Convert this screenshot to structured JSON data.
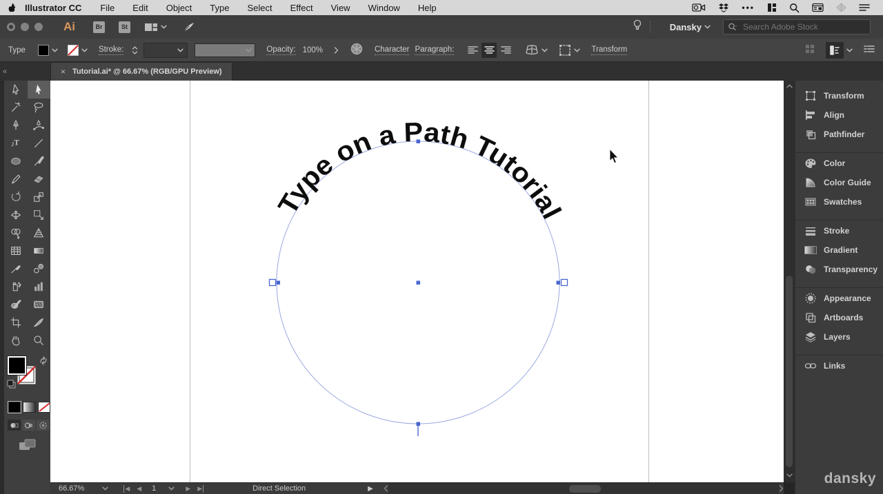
{
  "menubar": {
    "app_name": "Illustrator CC",
    "menus": [
      "File",
      "Edit",
      "Object",
      "Type",
      "Select",
      "Effect",
      "View",
      "Window",
      "Help"
    ],
    "status_icons": [
      "screen-record-icon",
      "dropbox-icon",
      "more-icon",
      "window-layout-icon",
      "search-icon",
      "calculator-icon",
      "assistant-icon",
      "list-icon"
    ],
    "more_glyph": "•••"
  },
  "titlebar": {
    "logo": "Ai",
    "bridge_button": "Br",
    "stock_button": "St",
    "workspace": "Dansky",
    "search_placeholder": "Search Adobe Stock"
  },
  "controlbar": {
    "selection_label": "Type",
    "stroke_label": "Stroke:",
    "opacity_label": "Opacity:",
    "opacity_value": "100%",
    "character_label": "Character",
    "paragraph_label": "Paragraph:",
    "transform_label": "Transform"
  },
  "tabbar": {
    "collapse": "«",
    "close": "×",
    "title": "Tutorial.ai* @ 66.67% (RGB/GPU Preview)"
  },
  "toolbar": {
    "tools": [
      "selection",
      "direct-selection",
      "magic-wand",
      "lasso",
      "pen",
      "curvature",
      "type",
      "line-segment",
      "ellipse",
      "paintbrush",
      "pencil",
      "eraser",
      "rotate",
      "scale",
      "width",
      "free-transform",
      "shape-builder",
      "perspective-grid",
      "mesh",
      "gradient",
      "eyedropper",
      "blend",
      "symbol-sprayer",
      "column-graph",
      "live-paint-bucket",
      "live-paint-selection",
      "artboard",
      "slice",
      "hand",
      "zoom"
    ],
    "selected_tool": "direct-selection"
  },
  "canvas": {
    "path_text": "Type on a Path Tutorial"
  },
  "dock": {
    "panels": [
      {
        "label": "Transform"
      },
      {
        "label": "Align"
      },
      {
        "label": "Pathfinder"
      },
      {
        "label": "Color"
      },
      {
        "label": "Color Guide"
      },
      {
        "label": "Swatches"
      },
      {
        "label": "Stroke"
      },
      {
        "label": "Gradient"
      },
      {
        "label": "Transparency"
      },
      {
        "label": "Appearance"
      },
      {
        "label": "Artboards"
      },
      {
        "label": "Layers"
      },
      {
        "label": "Links"
      }
    ]
  },
  "statusbar": {
    "zoom": "66.67%",
    "artboard_number": "1",
    "tool_name": "Direct Selection"
  },
  "watermark": "dansky",
  "colors": {
    "selection_blue": "#4a66d0",
    "path_stroke": "#9aa8e0",
    "logo_orange": "#d9995f",
    "none_red": "#d42a2a"
  }
}
